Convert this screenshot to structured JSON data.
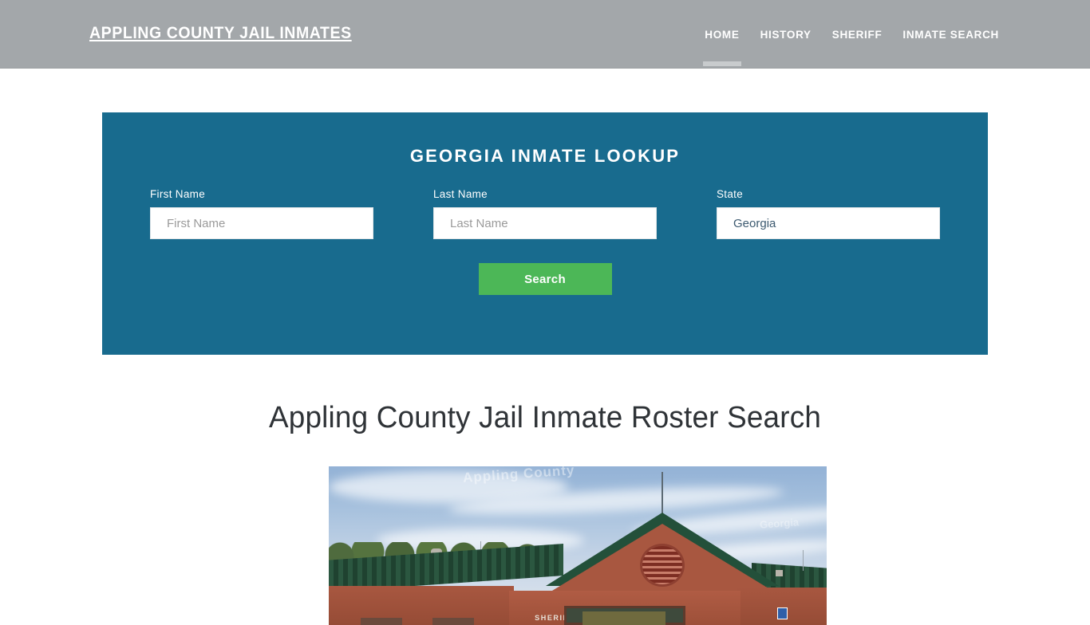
{
  "header": {
    "brand": "APPLING COUNTY JAIL INMATES",
    "nav": [
      {
        "label": "HOME",
        "active": true
      },
      {
        "label": "HISTORY",
        "active": false
      },
      {
        "label": "SHERIFF",
        "active": false
      },
      {
        "label": "INMATE SEARCH",
        "active": false
      }
    ]
  },
  "lookup": {
    "title": "GEORGIA INMATE LOOKUP",
    "first_name": {
      "label": "First Name",
      "placeholder": "First Name",
      "value": ""
    },
    "last_name": {
      "label": "Last Name",
      "placeholder": "Last Name",
      "value": ""
    },
    "state": {
      "label": "State",
      "value": "Georgia"
    },
    "search_button": "Search"
  },
  "article": {
    "title": "Appling County Jail Inmate Roster Search",
    "photo": {
      "alt": "Appling County Sheriff's Office building",
      "building_sign": "SHERIFF'S OFFICE",
      "watermark": "Appling County",
      "watermark2": "Georgia"
    }
  },
  "colors": {
    "header_gray": "#a3a7aa",
    "panel_teal": "#186b8e",
    "button_green": "#4cb757",
    "heading_dark": "#2f3337",
    "input_white": "#ffffff",
    "nav_underline": "#c8cbcd"
  }
}
